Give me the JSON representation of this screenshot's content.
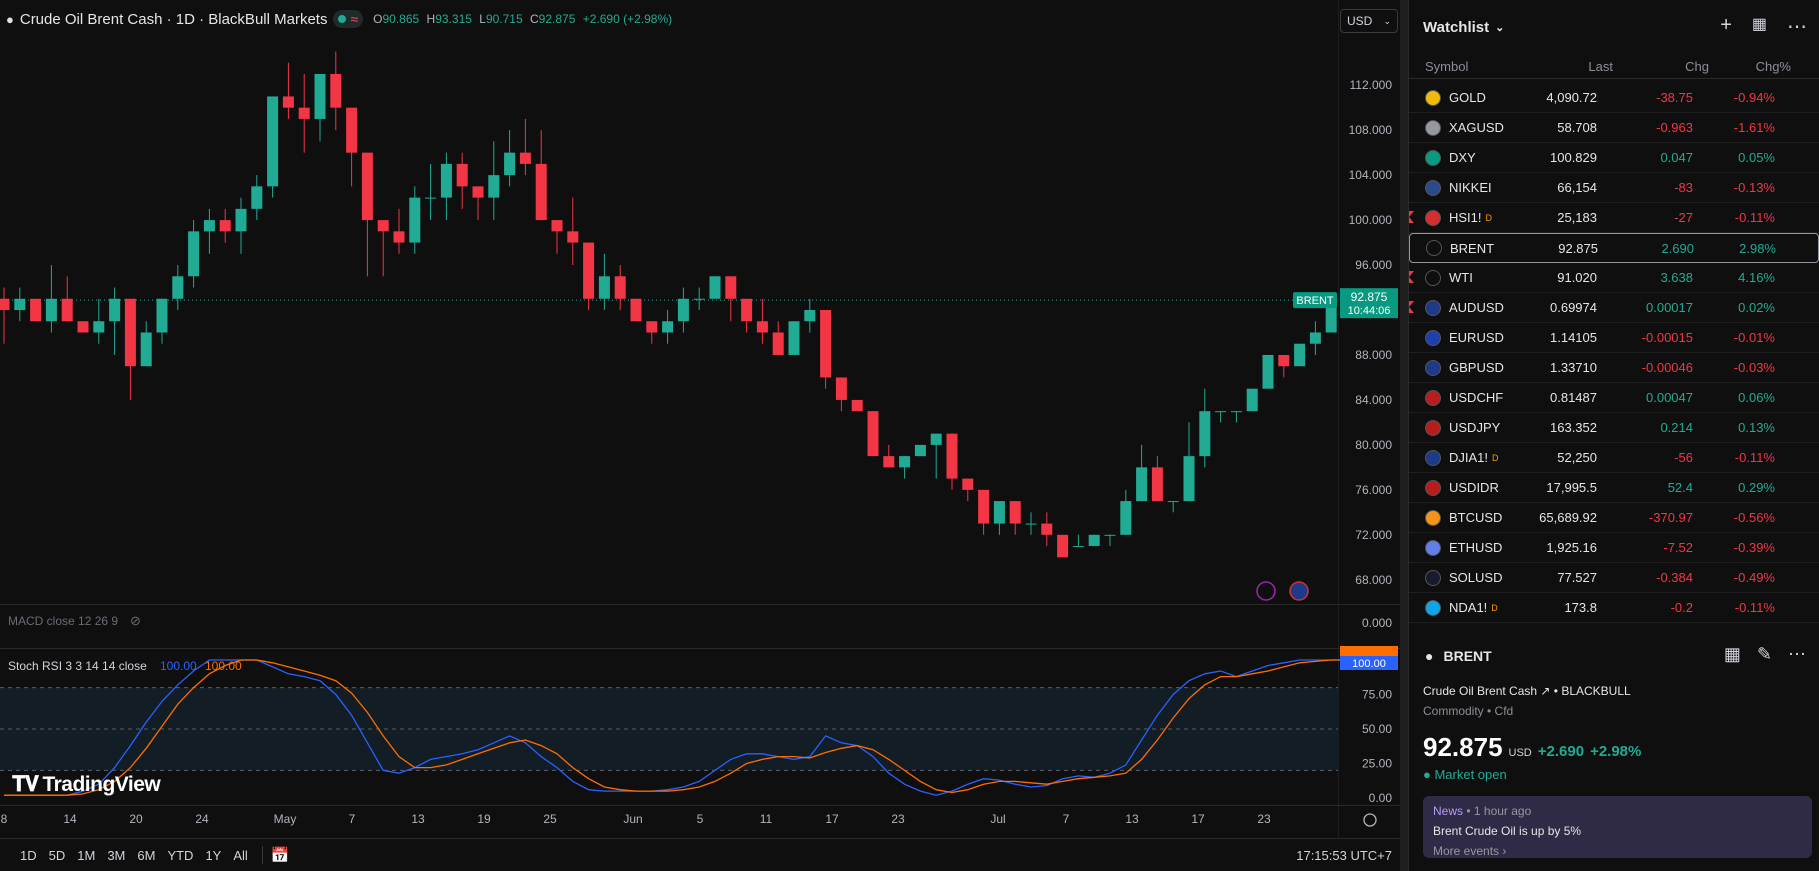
{
  "header": {
    "symbol_title": "Crude Oil Brent Cash · 1D · BlackBull Markets",
    "open_label": "O",
    "open": "90.865",
    "high_label": "H",
    "high": "93.315",
    "low_label": "L",
    "low": "90.715",
    "close_label": "C",
    "close": "92.875",
    "change": "+2.690 (+2.98%)",
    "currency": "USD"
  },
  "chart_data": {
    "type": "candlestick",
    "instrument": "BRENT",
    "price_axis_ticks": [
      "112.000",
      "108.000",
      "104.000",
      "100.000",
      "96.000",
      "92.000",
      "88.000",
      "84.000",
      "80.000",
      "76.000",
      "72.000",
      "68.000",
      "0.000"
    ],
    "ylim": [
      66.2,
      116.2
    ],
    "last_price": "92.875",
    "last_label": "BRENT",
    "countdown": "10:44:06",
    "x_ticks": [
      "8",
      "14",
      "20",
      "24",
      "May",
      "7",
      "13",
      "19",
      "25",
      "Jun",
      "5",
      "11",
      "17",
      "23",
      "Jul",
      "7",
      "13",
      "17",
      "23"
    ],
    "candles": [
      [
        93,
        94,
        89,
        92
      ],
      [
        92,
        94,
        91,
        93
      ],
      [
        93,
        93,
        91,
        91
      ],
      [
        91,
        96,
        90,
        93
      ],
      [
        93,
        95,
        91,
        91
      ],
      [
        91,
        91,
        90,
        90
      ],
      [
        90,
        93,
        89,
        91
      ],
      [
        91,
        94,
        88,
        93
      ],
      [
        93,
        93,
        84,
        87
      ],
      [
        87,
        91,
        88,
        90
      ],
      [
        90,
        92,
        89,
        93
      ],
      [
        93,
        96,
        92,
        95
      ],
      [
        95,
        100,
        94,
        99
      ],
      [
        99,
        101,
        97,
        100
      ],
      [
        100,
        101,
        98,
        99
      ],
      [
        99,
        102,
        97,
        101
      ],
      [
        101,
        104,
        100,
        103
      ],
      [
        103,
        110,
        102,
        111
      ],
      [
        111,
        114,
        109,
        110
      ],
      [
        110,
        113,
        106,
        109
      ],
      [
        109,
        113,
        107,
        113
      ],
      [
        113,
        115,
        108,
        110
      ],
      [
        110,
        108,
        103,
        106
      ],
      [
        106,
        104,
        95,
        100
      ],
      [
        100,
        98,
        95,
        99
      ],
      [
        99,
        101,
        97,
        98
      ],
      [
        98,
        103,
        97,
        102
      ],
      [
        102,
        105,
        100,
        102
      ],
      [
        102,
        106,
        100,
        105
      ],
      [
        105,
        106,
        101,
        103
      ],
      [
        103,
        102,
        100,
        102
      ],
      [
        102,
        107,
        100,
        104
      ],
      [
        104,
        108,
        103,
        106
      ],
      [
        106,
        109,
        104,
        105
      ],
      [
        105,
        108,
        101,
        100
      ],
      [
        100,
        100,
        97,
        99
      ],
      [
        99,
        102,
        96,
        98
      ],
      [
        98,
        95,
        92,
        93
      ],
      [
        93,
        97,
        92,
        95
      ],
      [
        95,
        96,
        92,
        93
      ],
      [
        93,
        93,
        91,
        91
      ],
      [
        91,
        91,
        89,
        90
      ],
      [
        90,
        92,
        89,
        91
      ],
      [
        91,
        94,
        90,
        93
      ],
      [
        93,
        94,
        92,
        93
      ],
      [
        93,
        95,
        94,
        95
      ],
      [
        95,
        94,
        91,
        93
      ],
      [
        93,
        93,
        90,
        91
      ],
      [
        91,
        93,
        89,
        90
      ],
      [
        90,
        91,
        88,
        88
      ],
      [
        88,
        91,
        89,
        91
      ],
      [
        91,
        93,
        90,
        92
      ],
      [
        92,
        92,
        85,
        86
      ],
      [
        86,
        86,
        83,
        84
      ],
      [
        84,
        84,
        83,
        83
      ],
      [
        83,
        82,
        79,
        79
      ],
      [
        79,
        80,
        78,
        78
      ],
      [
        78,
        79,
        77,
        79
      ],
      [
        79,
        80,
        79,
        80
      ],
      [
        80,
        81,
        77,
        81
      ],
      [
        81,
        77,
        76,
        77
      ],
      [
        77,
        77,
        75,
        76
      ],
      [
        76,
        75,
        72,
        73
      ],
      [
        73,
        75,
        72,
        75
      ],
      [
        75,
        75,
        72,
        73
      ],
      [
        73,
        74,
        72,
        73
      ],
      [
        73,
        74,
        71,
        72
      ],
      [
        72,
        72,
        71,
        70
      ],
      [
        71,
        72,
        71,
        71
      ],
      [
        71,
        72,
        71,
        72
      ],
      [
        72,
        72,
        71,
        72
      ],
      [
        72,
        76,
        72,
        75
      ],
      [
        75,
        80,
        76,
        78
      ],
      [
        78,
        79,
        75,
        75
      ],
      [
        75,
        75,
        74,
        75
      ],
      [
        75,
        82,
        77,
        79
      ],
      [
        79,
        85,
        78,
        83
      ],
      [
        83,
        83,
        82,
        83
      ],
      [
        83,
        82,
        82,
        83
      ],
      [
        83,
        85,
        83,
        85
      ],
      [
        85,
        88,
        85,
        88
      ],
      [
        88,
        88,
        86,
        87
      ],
      [
        87,
        89,
        87,
        89
      ],
      [
        89,
        91,
        88,
        90
      ],
      [
        90,
        93,
        91,
        93
      ]
    ],
    "macd_label": "MACD close 12 26 9",
    "stoch": {
      "label": "Stoch RSI 3 3 14 14 close",
      "k_value": "100.00",
      "d_value": "100.00",
      "k_color": "#2962ff",
      "d_color": "#ff6d00",
      "ylim": [
        0,
        100
      ],
      "ticks": [
        "75.00",
        "50.00",
        "25.00",
        "0.00"
      ],
      "bands": [
        20,
        50,
        80
      ],
      "k": [
        2,
        2,
        2,
        2,
        2,
        5,
        10,
        22,
        38,
        55,
        70,
        82,
        92,
        100,
        100,
        100,
        100,
        95,
        90,
        88,
        85,
        75,
        60,
        40,
        20,
        18,
        22,
        28,
        30,
        32,
        35,
        40,
        45,
        40,
        30,
        22,
        12,
        6,
        5,
        5,
        5,
        5,
        6,
        8,
        12,
        20,
        28,
        32,
        32,
        30,
        28,
        30,
        45,
        40,
        38,
        30,
        18,
        10,
        5,
        2,
        5,
        10,
        14,
        13,
        10,
        8,
        9,
        14,
        16,
        15,
        18,
        24,
        42,
        60,
        75,
        85,
        90,
        92,
        88,
        92,
        96,
        98,
        100,
        100,
        100,
        100,
        100
      ],
      "d": [
        2,
        2,
        2,
        2,
        2,
        3,
        6,
        12,
        22,
        36,
        52,
        68,
        80,
        90,
        96,
        100,
        100,
        98,
        95,
        92,
        89,
        85,
        76,
        62,
        45,
        30,
        22,
        22,
        24,
        28,
        32,
        36,
        40,
        42,
        38,
        32,
        22,
        14,
        8,
        6,
        5,
        5,
        5,
        6,
        8,
        12,
        18,
        25,
        28,
        30,
        30,
        29,
        33,
        36,
        38,
        35,
        28,
        20,
        12,
        6,
        4,
        6,
        10,
        12,
        12,
        11,
        10,
        12,
        14,
        15,
        16,
        18,
        28,
        42,
        58,
        72,
        82,
        88,
        88,
        90,
        92,
        95,
        98,
        99,
        100,
        100,
        100
      ]
    }
  },
  "range_buttons": [
    "1D",
    "5D",
    "1M",
    "3M",
    "6M",
    "YTD",
    "1Y",
    "All"
  ],
  "clock": "17:15:53 UTC+7",
  "watchlist": {
    "title": "Watchlist",
    "columns": [
      "Symbol",
      "Last",
      "Chg",
      "Chg%"
    ],
    "rows": [
      {
        "symbol": "GOLD",
        "sup": "",
        "last": "4,090.72",
        "chg": "-38.75",
        "pct": "-0.94%",
        "dir": "dn",
        "flag": false,
        "sel": false,
        "icon_color": "#f0b90b",
        "icon": "gold-icon"
      },
      {
        "symbol": "XAGUSD",
        "sup": "",
        "last": "58.708",
        "chg": "-0.963",
        "pct": "-1.61%",
        "dir": "dn",
        "flag": false,
        "sel": false,
        "icon_color": "#9598a1",
        "icon": "silver-icon"
      },
      {
        "symbol": "DXY",
        "sup": "",
        "last": "100.829",
        "chg": "0.047",
        "pct": "0.05%",
        "dir": "up",
        "flag": false,
        "sel": false,
        "icon_color": "#089981",
        "icon": "dollar-icon"
      },
      {
        "symbol": "NIKKEI",
        "sup": "",
        "last": "66,154",
        "chg": "-83",
        "pct": "-0.13%",
        "dir": "dn",
        "flag": false,
        "sel": false,
        "icon_color": "#2a4a8a",
        "icon": "index-225-icon"
      },
      {
        "symbol": "HSI1!",
        "sup": "D",
        "last": "25,183",
        "chg": "-27",
        "pct": "-0.11%",
        "dir": "dn",
        "flag": true,
        "sel": false,
        "icon_color": "#d32f2f",
        "icon": "hsi-icon"
      },
      {
        "symbol": "BRENT",
        "sup": "",
        "last": "92.875",
        "chg": "2.690",
        "pct": "2.98%",
        "dir": "up",
        "flag": false,
        "sel": true,
        "icon_color": "#0f0f0f",
        "icon": "oil-drop-icon"
      },
      {
        "symbol": "WTI",
        "sup": "",
        "last": "91.020",
        "chg": "3.638",
        "pct": "4.16%",
        "dir": "up",
        "flag": true,
        "sel": false,
        "icon_color": "#0f0f0f",
        "icon": "oil-drop-icon"
      },
      {
        "symbol": "AUDUSD",
        "sup": "",
        "last": "0.69974",
        "chg": "0.00017",
        "pct": "0.02%",
        "dir": "up",
        "flag": true,
        "sel": false,
        "icon_color": "#1e3a8a",
        "icon": "aud-usd-flags-icon"
      },
      {
        "symbol": "EURUSD",
        "sup": "",
        "last": "1.14105",
        "chg": "-0.00015",
        "pct": "-0.01%",
        "dir": "dn",
        "flag": false,
        "sel": false,
        "icon_color": "#1e40af",
        "icon": "eur-usd-flags-icon"
      },
      {
        "symbol": "GBPUSD",
        "sup": "",
        "last": "1.33710",
        "chg": "-0.00046",
        "pct": "-0.03%",
        "dir": "dn",
        "flag": false,
        "sel": false,
        "icon_color": "#1e3a8a",
        "icon": "gbp-usd-flags-icon"
      },
      {
        "symbol": "USDCHF",
        "sup": "",
        "last": "0.81487",
        "chg": "0.00047",
        "pct": "0.06%",
        "dir": "up",
        "flag": false,
        "sel": false,
        "icon_color": "#b91c1c",
        "icon": "usd-chf-flags-icon"
      },
      {
        "symbol": "USDJPY",
        "sup": "",
        "last": "163.352",
        "chg": "0.214",
        "pct": "0.13%",
        "dir": "up",
        "flag": false,
        "sel": false,
        "icon_color": "#b91c1c",
        "icon": "usd-jpy-flags-icon"
      },
      {
        "symbol": "DJIA1!",
        "sup": "D",
        "last": "52,250",
        "chg": "-56",
        "pct": "-0.11%",
        "dir": "dn",
        "flag": false,
        "sel": false,
        "icon_color": "#1e3a8a",
        "icon": "us-flag-icon"
      },
      {
        "symbol": "USDIDR",
        "sup": "",
        "last": "17,995.5",
        "chg": "52.4",
        "pct": "0.29%",
        "dir": "up",
        "flag": false,
        "sel": false,
        "icon_color": "#b91c1c",
        "icon": "usd-idr-flags-icon"
      },
      {
        "symbol": "BTCUSD",
        "sup": "",
        "last": "65,689.92",
        "chg": "-370.97",
        "pct": "-0.56%",
        "dir": "dn",
        "flag": false,
        "sel": false,
        "icon_color": "#f7931a",
        "icon": "bitcoin-icon"
      },
      {
        "symbol": "ETHUSD",
        "sup": "",
        "last": "1,925.16",
        "chg": "-7.52",
        "pct": "-0.39%",
        "dir": "dn",
        "flag": false,
        "sel": false,
        "icon_color": "#627eea",
        "icon": "ethereum-icon"
      },
      {
        "symbol": "SOLUSD",
        "sup": "",
        "last": "77.527",
        "chg": "-0.384",
        "pct": "-0.49%",
        "dir": "dn",
        "flag": false,
        "sel": false,
        "icon_color": "#1a1a2e",
        "icon": "solana-icon"
      },
      {
        "symbol": "NDA1!",
        "sup": "D",
        "last": "173.8",
        "chg": "-0.2",
        "pct": "-0.11%",
        "dir": "dn",
        "flag": false,
        "sel": false,
        "icon_color": "#0ea5e9",
        "icon": "index-100-icon"
      }
    ]
  },
  "detail": {
    "symbol": "BRENT",
    "name": "Crude Oil Brent Cash",
    "exchange": "BLACKBULL",
    "category": "Commodity • Cfd",
    "price": "92.875",
    "currency": "USD",
    "change": "+2.690",
    "change_pct": "+2.98%",
    "status": "Market open",
    "news": {
      "tag": "News",
      "time": "• 1 hour ago",
      "headline": "Brent Crude Oil is up by 5%",
      "more": "More events"
    }
  },
  "logo_text": "TradingView",
  "colors": {
    "up": "#22ab94",
    "down": "#f23645",
    "accent": "#089981"
  }
}
